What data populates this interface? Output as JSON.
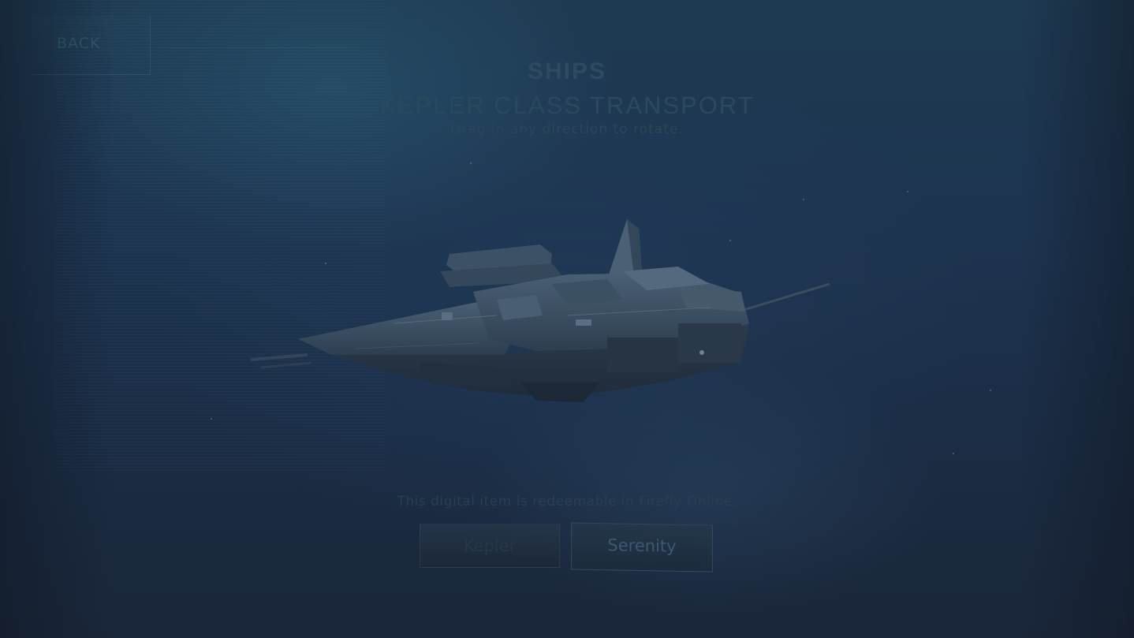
{
  "nav": {
    "back_label": "BACK"
  },
  "header": {
    "section_title": "SHIPS",
    "ship_name": "KEPLER CLASS TRANSPORT",
    "hint": "Drag in any direction to rotate."
  },
  "viewer": {
    "subject": "kepler-class-transport-ship-model"
  },
  "footer": {
    "redeem_text": "This digital item is redeemable in Firefly Online.",
    "buttons": [
      {
        "label": "Kepler",
        "state": "inactive"
      },
      {
        "label": "Serenity",
        "state": "active"
      }
    ]
  },
  "colors": {
    "background": "#1b2a3f",
    "title_text": "#2c4b5f",
    "button_active_text": "#3d5870"
  }
}
